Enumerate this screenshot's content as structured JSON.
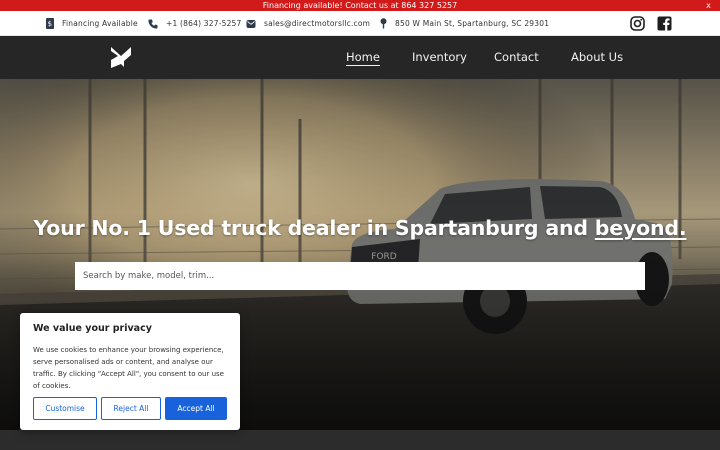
{
  "announcement": {
    "text": "Financing available! Contact us at 864 327 5257",
    "close_label": "x"
  },
  "infobar": {
    "financing": "Financing Available",
    "phone": "+1 (864) 327-5257",
    "email": "sales@directmotorsllc.com",
    "address": "850 W Main St, Spartanburg, SC 29301",
    "icons": [
      "financing-icon",
      "phone-icon",
      "email-icon",
      "location-icon"
    ],
    "social": [
      "instagram-icon",
      "facebook-icon"
    ]
  },
  "nav": {
    "items": [
      {
        "label": "Home",
        "active": true
      },
      {
        "label": "Inventory",
        "active": false
      },
      {
        "label": "Contact",
        "active": false
      },
      {
        "label": "About Us",
        "active": false
      }
    ]
  },
  "hero": {
    "title_main": "Your No. 1 Used truck dealer in Spartanburg and ",
    "title_emphasis": "beyond.",
    "search_placeholder": "Search by make, model, trim..."
  },
  "cookie": {
    "title": "We value your privacy",
    "text": "We use cookies to enhance your browsing experience, serve personalised ads or content, and analyse our traffic. By clicking \"Accept All\", you consent to our use of cookies.",
    "customise": "Customise",
    "reject": "Reject All",
    "accept": "Accept All"
  },
  "colors": {
    "announce_bg": "#d11b1b",
    "nav_bg": "#262626",
    "accent_blue": "#1863dc"
  }
}
